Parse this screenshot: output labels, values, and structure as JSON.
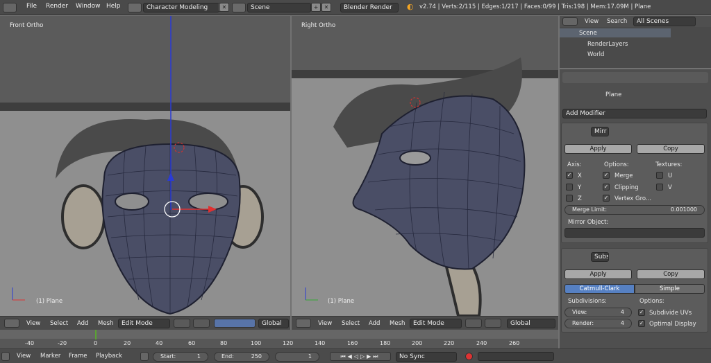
{
  "topbar": {
    "menus": [
      "File",
      "Render",
      "Window",
      "Help"
    ],
    "screen_layout": "Character Modeling",
    "scene": "Scene",
    "render_engine": "Blender Render",
    "stats": "v2.74 | Verts:2/115 | Edges:1/217 | Faces:0/99 | Tris:198 | Mem:17.09M | Plane"
  },
  "viewport_left": {
    "title": "Front Ortho",
    "object": "(1) Plane"
  },
  "viewport_right": {
    "title": "Right Ortho",
    "object": "(1) Plane"
  },
  "header3d": {
    "menus": [
      "View",
      "Select",
      "Add",
      "Mesh"
    ],
    "mode": "Edit Mode",
    "orientation": "Global"
  },
  "outliner": {
    "menus": [
      "View",
      "Search"
    ],
    "filter": "All Scenes",
    "items": [
      "Scene",
      "RenderLayers",
      "World"
    ]
  },
  "properties": {
    "object_name": "Plane",
    "add_modifier": "Add Modifier",
    "mirror": {
      "name": "Mirr",
      "apply": "Apply",
      "copy": "Copy",
      "axis_label": "Axis:",
      "options_label": "Options:",
      "textures_label": "Textures:",
      "x": "X",
      "y": "Y",
      "z": "Z",
      "merge": "Merge",
      "clipping": "Clipping",
      "vertex_groups": "Vertex Gro...",
      "u": "U",
      "v": "V",
      "merge_limit_label": "Merge Limit:",
      "merge_limit_value": "0.001000",
      "mirror_object_label": "Mirror Object:"
    },
    "subsurf": {
      "name": "Subs",
      "apply": "Apply",
      "copy": "Copy",
      "catmull": "Catmull-Clark",
      "simple": "Simple",
      "subdivisions_label": "Subdivisions:",
      "options_label": "Options:",
      "view_label": "View:",
      "view_value": "4",
      "render_label": "Render:",
      "render_value": "4",
      "subdivide_uvs": "Subdivide UVs",
      "optimal_display": "Optimal Display"
    }
  },
  "timeline": {
    "ticks": [
      "-40",
      "-20",
      "0",
      "20",
      "40",
      "60",
      "80",
      "100",
      "120",
      "140",
      "160",
      "180",
      "200",
      "220",
      "240",
      "260"
    ],
    "menus": [
      "View",
      "Marker",
      "Frame",
      "Playback"
    ],
    "start_label": "Start:",
    "start": "1",
    "end_label": "End:",
    "end": "250",
    "current": "1",
    "sync": "No Sync"
  }
}
